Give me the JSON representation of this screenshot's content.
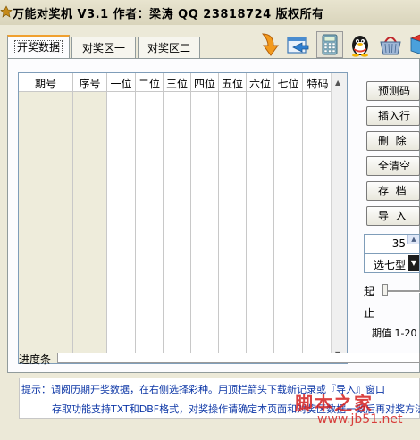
{
  "window": {
    "title_icon": "star-icon",
    "title": "万能对奖机 V3.1 作者：梁涛 QQ 23818724 版权所有"
  },
  "tabs": [
    {
      "label": "开奖数据",
      "active": true
    },
    {
      "label": "对奖区一",
      "active": false
    },
    {
      "label": "对奖区二",
      "active": false
    }
  ],
  "toolbar": [
    {
      "icon": "download-arrow-icon"
    },
    {
      "icon": "export-icon"
    },
    {
      "icon": "calculator-icon"
    },
    {
      "icon": "qq-penguin-icon"
    },
    {
      "icon": "basket-icon"
    },
    {
      "icon": "book-icon"
    }
  ],
  "grid": {
    "columns": [
      "期号",
      "序号",
      "一位",
      "二位",
      "三位",
      "四位",
      "五位",
      "六位",
      "七位",
      "特码"
    ],
    "rows": []
  },
  "side_buttons": {
    "predict": "预测码",
    "insert_row": "插入行",
    "delete": "删  除",
    "clear_all": "全清空",
    "save": "存  档",
    "import": "导  入"
  },
  "spinner": {
    "value": "35"
  },
  "type_select": {
    "value": "选七型"
  },
  "range": {
    "start_label": "起",
    "end_label": "止",
    "period_text": "期值 1-20"
  },
  "progress": {
    "label": "进度条",
    "value": 0
  },
  "hint": {
    "line1": "提示：调阅历期开奖数据，在右侧选择彩种。用顶栏箭头下载新记录或『导入』窗口",
    "line2": "存取功能支持TXT和DBF格式，对奖操作请确定本页面和对奖区数据一致后再对奖方法"
  },
  "watermark": {
    "text": "脚本之家",
    "url": "www.jb51.net"
  }
}
